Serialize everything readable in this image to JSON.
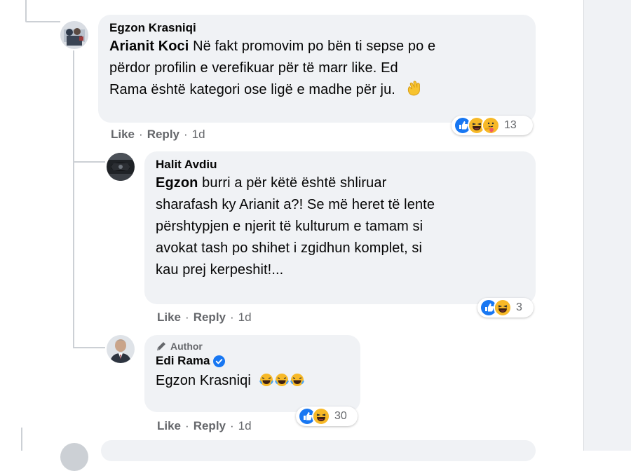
{
  "comments": [
    {
      "author": "Egzon Krasniqi",
      "mention": "Arianit Koci",
      "text_line1": " Në fakt promovim po bën ti sepse po e",
      "text_line2": "përdor profilin e verefikuar për të marr like. Ed",
      "text_line3": "Rama është kategori ose ligë e madhe për ju.",
      "emoji": "waving-hand",
      "like_label": "Like",
      "reply_label": "Reply",
      "time": "1d",
      "reaction_count": "13",
      "reactions": [
        "like",
        "haha",
        "care"
      ]
    },
    {
      "author": "Halit Avdiu",
      "mention": "Egzon",
      "text_line1": " burri a për këtë është shliruar",
      "text_line2": "sharafash ky Arianit a?! Se më heret të lente",
      "text_line3": "përshtypjen e njerit të kulturum e tamam si",
      "text_line4": "avokat tash po shihet i zgidhun komplet, si",
      "text_line5": "kau prej kerpeshit!...",
      "like_label": "Like",
      "reply_label": "Reply",
      "time": "1d",
      "reaction_count": "3",
      "reactions": [
        "like",
        "haha"
      ]
    },
    {
      "badge": "Author",
      "author": "Edi Rama",
      "verified": true,
      "mention": "Egzon Krasniqi",
      "emoji": [
        "tears-of-joy",
        "tears-of-joy",
        "tears-of-joy"
      ],
      "like_label": "Like",
      "reply_label": "Reply",
      "time": "1d",
      "reaction_count": "30",
      "reactions": [
        "like",
        "haha"
      ]
    }
  ],
  "colors": {
    "bubble": "#f0f2f5",
    "meta": "#65676b",
    "like_blue": "#1877f2",
    "haha_yellow": "#f7b928",
    "verified_blue": "#1877f2"
  },
  "separator": "·"
}
